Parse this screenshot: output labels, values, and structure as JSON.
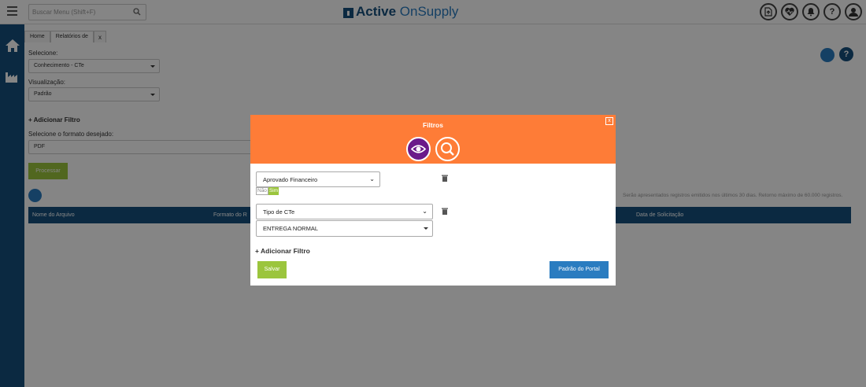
{
  "header": {
    "search_placeholder": "Buscar Menu (Shift+F)",
    "brand_bold": "Active",
    "brand_light": "OnSupply",
    "icons": [
      "file-upload-icon",
      "heartbeat-icon",
      "bell-icon",
      "help-icon",
      "user-icon"
    ],
    "help_label": "?"
  },
  "sidebar": {
    "icons": [
      "home-icon",
      "factory-icon"
    ]
  },
  "tabs": [
    {
      "label": "Home"
    },
    {
      "label": "Relatórios de"
    },
    {
      "label": "x"
    }
  ],
  "form": {
    "select_label": "Selecione:",
    "select_value": "Conhecimento - CTe",
    "view_label": "Visualização:",
    "view_value": "Padrão",
    "add_filter": "+ Adicionar Filtro",
    "format_label": "Selecione o formato desejado:",
    "format_value": "PDF",
    "generate_label": "Processar",
    "info": "Serão apresentados registros emitidos nos últimos 30 dias. Retorno máximo de 60.000 registros.",
    "help_label": "?"
  },
  "table": {
    "columns": [
      "Nome do Arquivo",
      "Formato do R",
      "Data de Solicitação"
    ]
  },
  "modal": {
    "title": "Filtros",
    "close": "x",
    "filter1": {
      "field": "Aprovado Financeiro",
      "toggle_no": "Não",
      "toggle_yes": "Sim"
    },
    "filter2": {
      "field": "Tipo de CTe",
      "value": "ENTREGA NORMAL"
    },
    "add_filter": "+ Adicionar Filtro",
    "save": "Salvar",
    "portal_default": "Padrão do Portal"
  },
  "colors": {
    "navy": "#16507e",
    "blue": "#2a7cc0",
    "orange": "#fe7c37",
    "purple": "#6b1a8a",
    "green": "#9bc53d"
  }
}
